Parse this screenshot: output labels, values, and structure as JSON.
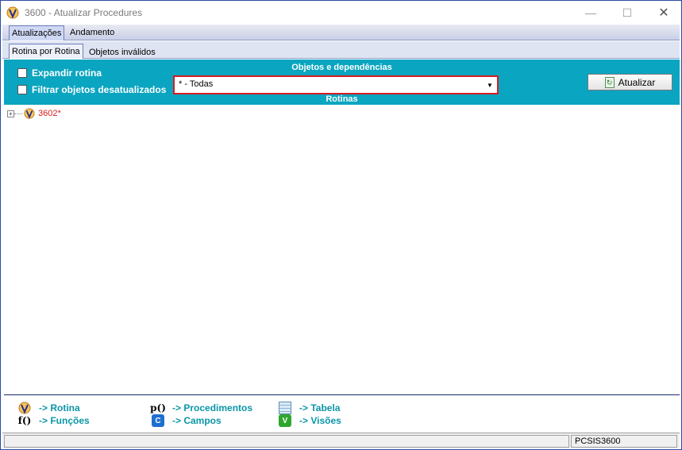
{
  "window": {
    "title": "3600 - Atualizar Procedures",
    "minimize_glyph": "—",
    "maximize_glyph": "☐",
    "close_glyph": "✕"
  },
  "outer_tabs": [
    {
      "label": "Atualizações",
      "active": true
    },
    {
      "label": "Andamento",
      "active": false
    }
  ],
  "sub_tabs": [
    {
      "label": "Rotina por Rotina",
      "active": true
    },
    {
      "label": "Objetos inválidos",
      "active": false
    }
  ],
  "panel": {
    "objetos_title": "Objetos e dependências",
    "rotinas_title": "Rotinas",
    "expandir_label": "Expandir rotina",
    "filtrar_label": "Filtrar objetos desatualizados",
    "expandir_checked": false,
    "filtrar_checked": false,
    "combo_value": "* - Todas",
    "atualizar_label": "Atualizar"
  },
  "tree": {
    "nodes": [
      {
        "label": "3602*",
        "expander": "+"
      }
    ]
  },
  "legend": {
    "rotina": "-> Rotina",
    "funcoes": "-> Funções",
    "procedimentos": "-> Procedimentos",
    "campos": "-> Campos",
    "tabela": "-> Tabela",
    "visoes": "-> Visões",
    "funcoes_icon": "f()",
    "proc_icon": "p()",
    "campos_icon": "C",
    "visoes_icon": "V"
  },
  "statusbar": {
    "right_text": "PCSIS3600"
  },
  "colors": {
    "panel_teal": "#0aa5c0",
    "highlight_red": "#d61c24",
    "tree_label_red": "#d81e1e",
    "legend_text": "#0b96a8"
  }
}
